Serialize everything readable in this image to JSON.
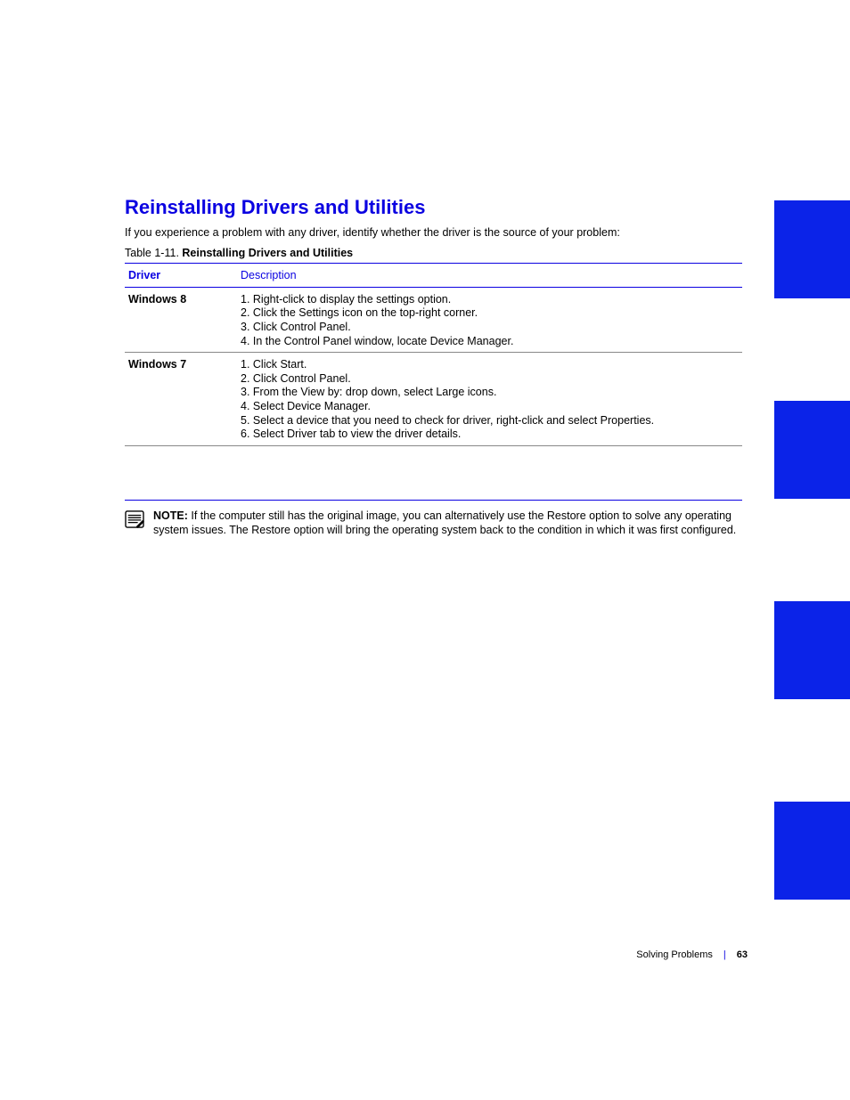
{
  "section": {
    "title": "Reinstalling Drivers and Utilities",
    "intro": "If you experience a problem with any driver, identify whether the driver is the source of your problem:"
  },
  "table": {
    "caption_label": "Table 1-11.",
    "caption_text": "Reinstalling Drivers and Utilities",
    "header": {
      "col1": "Driver",
      "col2": "Description"
    },
    "rows": [
      {
        "col1": "Windows 8",
        "col2_lines": [
          "1. Right-click to display the settings option.",
          "2. Click the Settings icon on the top-right corner.",
          "3. Click Control Panel.",
          "4. In the Control Panel window, locate Device Manager."
        ]
      },
      {
        "col1": "Windows 7",
        "col2_lines": [
          "1. Click Start.",
          "2. Click Control Panel.",
          "3. From the View by: drop down, select Large icons.",
          "4. Select Device Manager.",
          "5. Select a device that you need to check for driver, right-click and select Properties.",
          "6. Select Driver tab to view the driver details."
        ]
      }
    ]
  },
  "note": {
    "label": "NOTE:",
    "text": "If the computer still has the original image, you can alternatively use the Restore option to solve any operating system issues. The Restore option will bring the operating system back to the condition in which it was first configured."
  },
  "footer": {
    "title": "Solving Problems",
    "page": "63"
  },
  "tabs": [
    "",
    "",
    "",
    ""
  ]
}
